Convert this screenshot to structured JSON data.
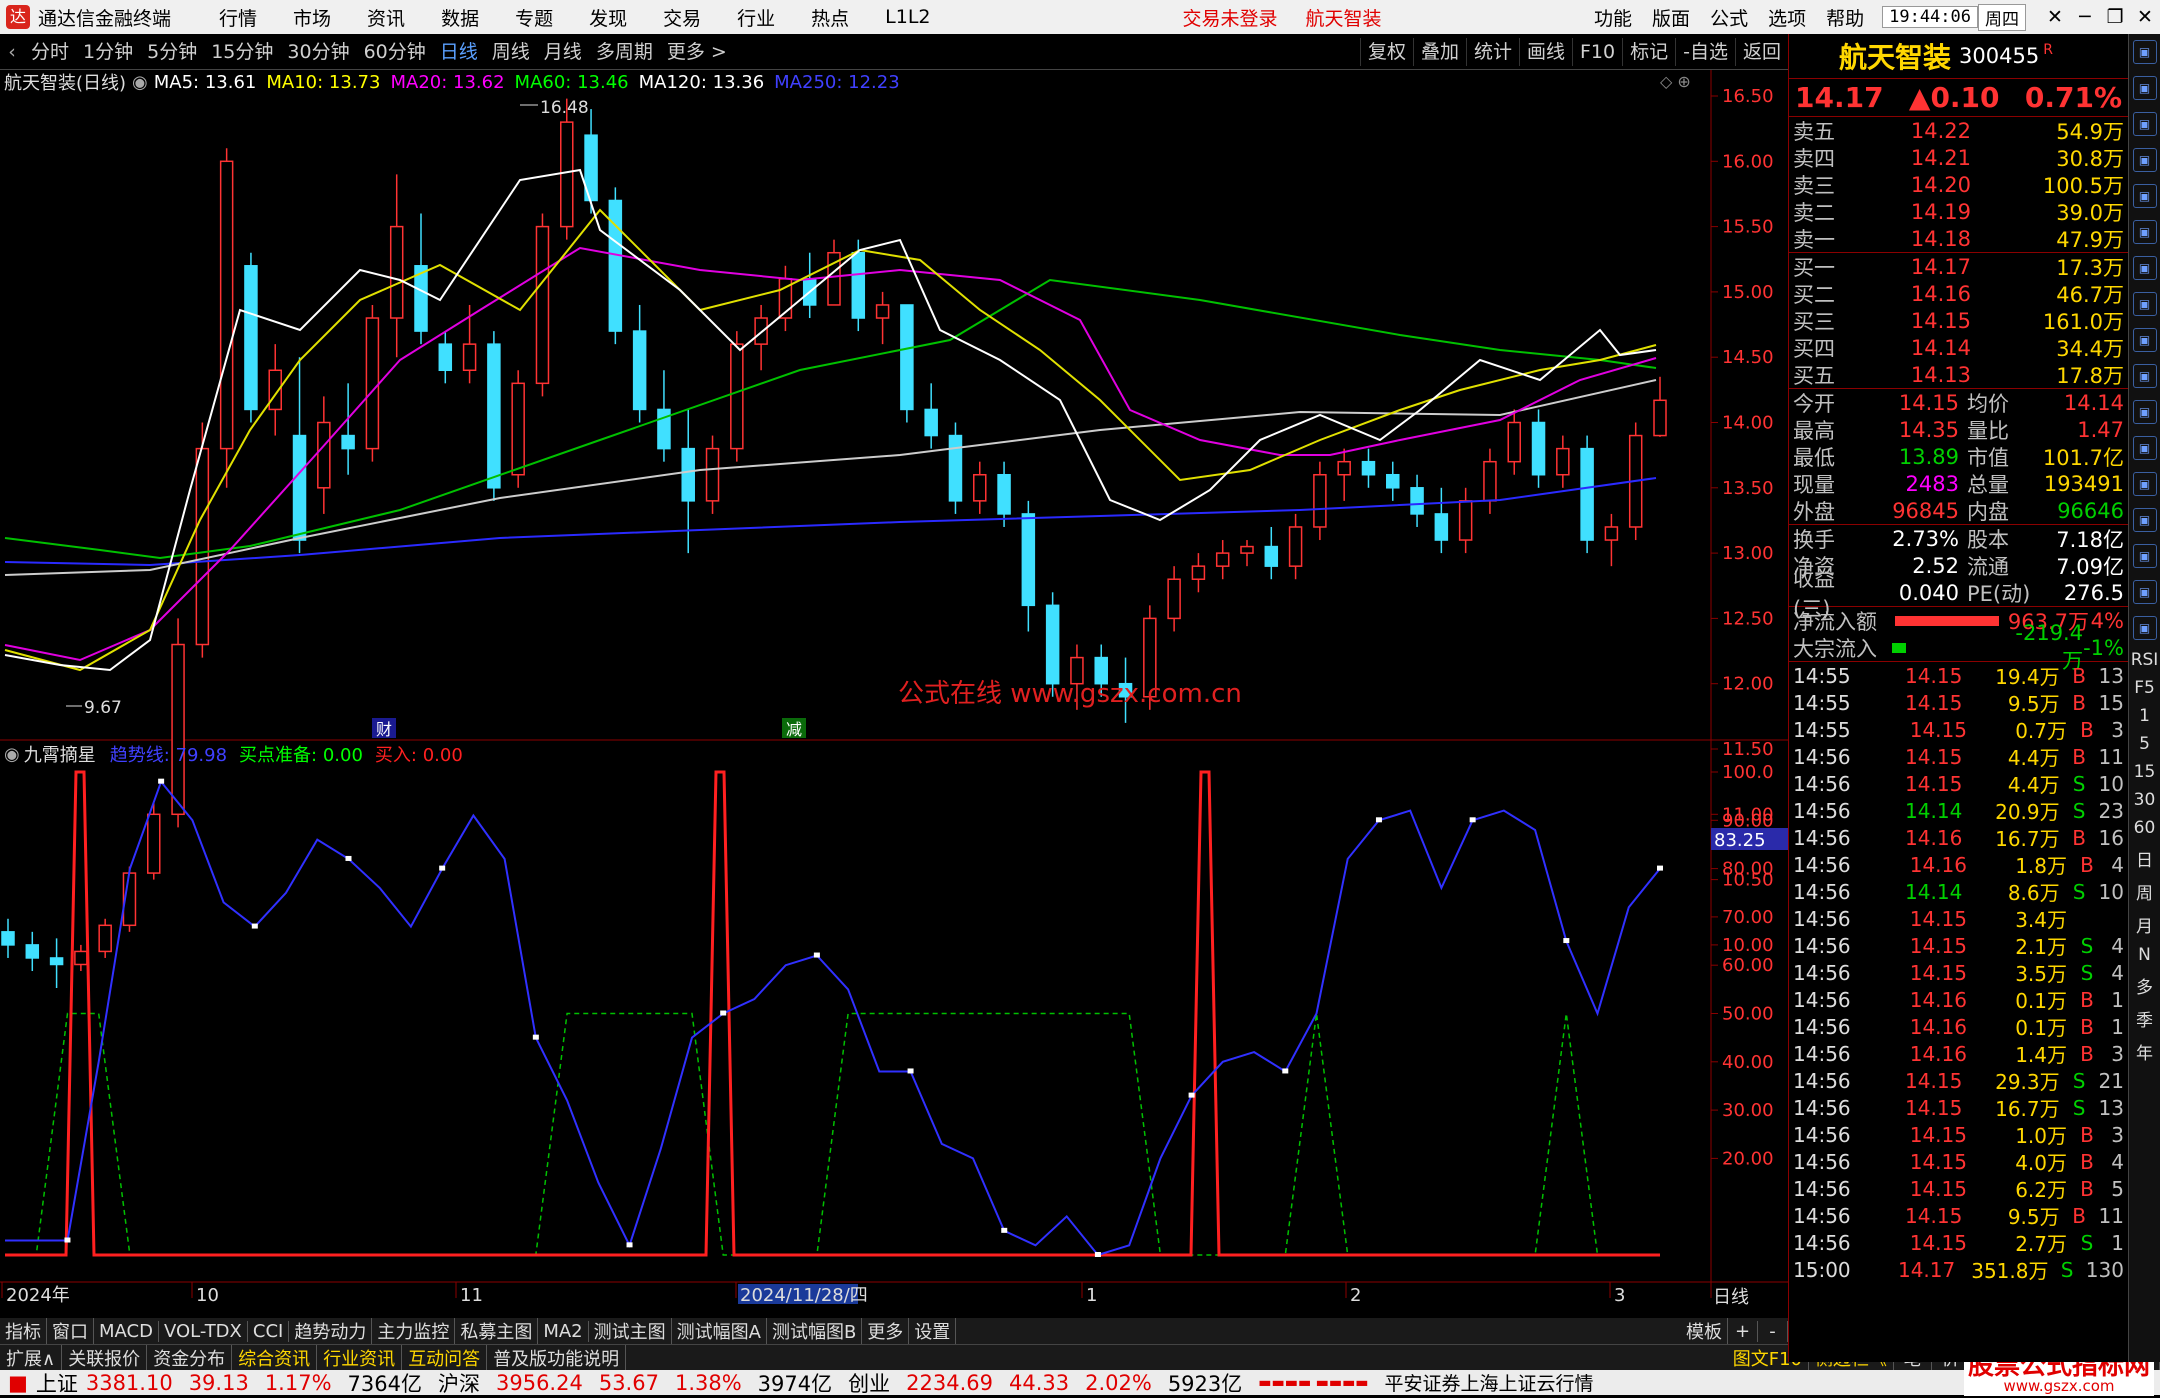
{
  "menubar": {
    "app_title": "通达信金融终端",
    "items": [
      "行情",
      "市场",
      "资讯",
      "数据",
      "专题",
      "发现",
      "交易",
      "行业",
      "热点",
      "L1L2"
    ],
    "trade_status": "交易未登录",
    "stock_name": "航天智装",
    "right_items": [
      "功能",
      "版面",
      "公式",
      "选项",
      "帮助"
    ],
    "time": "19:44:06",
    "weekday": "周四"
  },
  "toolbar": {
    "periods": [
      "分时",
      "1分钟",
      "5分钟",
      "15分钟",
      "30分钟",
      "60分钟",
      "日线",
      "周线",
      "月线",
      "多周期",
      "更多 >"
    ],
    "selected": "日线",
    "right": [
      "复权",
      "叠加",
      "统计",
      "画线",
      "F10",
      "标记",
      "-自选",
      "返回"
    ]
  },
  "main_chart": {
    "title": "航天智装(日线)",
    "ma_labels": [
      {
        "text": "MA5: 13.61",
        "color": "#ffffff"
      },
      {
        "text": "MA10: 13.73",
        "color": "#ffff00"
      },
      {
        "text": "MA20: 13.62",
        "color": "#ff00ff"
      },
      {
        "text": "MA60: 13.46",
        "color": "#00ff00"
      },
      {
        "text": "MA120: 13.36",
        "color": "#ffffff"
      },
      {
        "text": "MA250: 12.23",
        "color": "#4040ff"
      }
    ],
    "y_ticks": [
      "16.50",
      "16.00",
      "15.50",
      "15.00",
      "14.50",
      "14.00",
      "13.50",
      "13.00",
      "12.50",
      "12.00",
      "11.50",
      "11.00",
      "10.50",
      "10.00"
    ],
    "high_label": "16.48",
    "low_label": "9.67",
    "watermark": "公式在线 www.gszx.com.cn",
    "markers": [
      "财",
      "减"
    ]
  },
  "indicator": {
    "title": "九霄摘星",
    "lines": [
      {
        "text": "趋势线: 79.98",
        "color": "#4040ff"
      },
      {
        "text": "买点准备: 0.00",
        "color": "#00ff00"
      },
      {
        "text": "买入: 0.00",
        "color": "#ff2020"
      }
    ],
    "y_ticks": [
      "100.0",
      "90.00",
      "80.00",
      "70.00",
      "60.00",
      "50.00",
      "40.00",
      "30.00",
      "20.00"
    ],
    "current": "83.25"
  },
  "x_axis": {
    "labels": [
      "2024年",
      "10",
      "11",
      "2024/11/28/四",
      "1",
      "2",
      "3"
    ],
    "period": "日线"
  },
  "chart_data": {
    "type": "line",
    "x_labels": [
      "2024年",
      "10",
      "11",
      "2024/11/28/四",
      "1",
      "2",
      "3"
    ],
    "y_range": [
      0,
      100
    ],
    "series": [
      {
        "name": "趋势线",
        "values": [
          3,
          3,
          3,
          40,
          80,
          98,
          90,
          73,
          68,
          75,
          86,
          82,
          76,
          68,
          80,
          91,
          82,
          45,
          32,
          15,
          2,
          22,
          45,
          50,
          53,
          60,
          62,
          55,
          38,
          38,
          23,
          20,
          5,
          2,
          8,
          0,
          2,
          20,
          33,
          40,
          42,
          38,
          50,
          82,
          90,
          92,
          76,
          90,
          92,
          88,
          65,
          50,
          72,
          80
        ]
      },
      {
        "name": "买点准备",
        "values": [
          0,
          0,
          50,
          50,
          0,
          0,
          0,
          0,
          0,
          0,
          0,
          0,
          0,
          0,
          0,
          0,
          0,
          0,
          50,
          50,
          50,
          50,
          50,
          0,
          0,
          0,
          0,
          50,
          50,
          50,
          50,
          50,
          50,
          50,
          50,
          50,
          50,
          0,
          0,
          0,
          0,
          0,
          50,
          0,
          0,
          0,
          0,
          0,
          0,
          0,
          50,
          0,
          0,
          0
        ]
      }
    ]
  },
  "quote": {
    "name": "航天智装",
    "code": "300455",
    "flag": "R",
    "price": "14.17",
    "change": "▲0.10",
    "pct": "0.71%",
    "asks": [
      {
        "l": "卖五",
        "p": "14.22",
        "v": "54.9万"
      },
      {
        "l": "卖四",
        "p": "14.21",
        "v": "30.8万"
      },
      {
        "l": "卖三",
        "p": "14.20",
        "v": "100.5万"
      },
      {
        "l": "卖二",
        "p": "14.19",
        "v": "39.0万"
      },
      {
        "l": "卖一",
        "p": "14.18",
        "v": "47.9万"
      }
    ],
    "bids": [
      {
        "l": "买一",
        "p": "14.17",
        "v": "17.3万"
      },
      {
        "l": "买二",
        "p": "14.16",
        "v": "46.7万"
      },
      {
        "l": "买三",
        "p": "14.15",
        "v": "161.0万"
      },
      {
        "l": "买四",
        "p": "14.14",
        "v": "34.4万"
      },
      {
        "l": "买五",
        "p": "14.13",
        "v": "17.8万"
      }
    ],
    "stats": [
      [
        "今开",
        "14.15",
        "均价",
        "14.14"
      ],
      [
        "最高",
        "14.35",
        "量比",
        "1.47"
      ],
      [
        "最低",
        "13.89",
        "市值",
        "101.7亿"
      ],
      [
        "现量",
        "2483",
        "总量",
        "193491"
      ],
      [
        "外盘",
        "96845",
        "内盘",
        "96646"
      ]
    ],
    "stats2": [
      [
        "换手",
        "2.73%",
        "股本",
        "7.18亿"
      ],
      [
        "净资",
        "2.52",
        "流通",
        "7.09亿"
      ],
      [
        "收益(三)",
        "0.040",
        "PE(动)",
        "276.5"
      ]
    ],
    "flow": [
      {
        "l": "净流入额",
        "v": "963.7万",
        "p": "4%"
      },
      {
        "l": "大宗流入",
        "v": "-219.4万",
        "p": "-1%"
      }
    ]
  },
  "ticks": [
    [
      "14:55",
      "14.15",
      "19.4万",
      "B",
      "13"
    ],
    [
      "14:55",
      "14.15",
      "9.5万",
      "B",
      "15"
    ],
    [
      "14:55",
      "14.15",
      "0.7万",
      "B",
      "3"
    ],
    [
      "14:56",
      "14.15",
      "4.4万",
      "B",
      "11"
    ],
    [
      "14:56",
      "14.15",
      "4.4万",
      "S",
      "10"
    ],
    [
      "14:56",
      "14.14",
      "20.9万",
      "S",
      "23"
    ],
    [
      "14:56",
      "14.16",
      "16.7万",
      "B",
      "16"
    ],
    [
      "14:56",
      "14.16",
      "1.8万",
      "B",
      "4"
    ],
    [
      "14:56",
      "14.14",
      "8.6万",
      "S",
      "10"
    ],
    [
      "14:56",
      "14.15",
      "3.4万",
      "",
      ""
    ],
    [
      "14:56",
      "14.15",
      "2.1万",
      "S",
      "4"
    ],
    [
      "14:56",
      "14.15",
      "3.5万",
      "S",
      "4"
    ],
    [
      "14:56",
      "14.16",
      "0.1万",
      "B",
      "1"
    ],
    [
      "14:56",
      "14.16",
      "0.1万",
      "B",
      "1"
    ],
    [
      "14:56",
      "14.16",
      "1.4万",
      "B",
      "3"
    ],
    [
      "14:56",
      "14.15",
      "29.3万",
      "S",
      "21"
    ],
    [
      "14:56",
      "14.15",
      "16.7万",
      "S",
      "13"
    ],
    [
      "14:56",
      "14.15",
      "1.0万",
      "B",
      "3"
    ],
    [
      "14:56",
      "14.15",
      "4.0万",
      "B",
      "4"
    ],
    [
      "14:56",
      "14.15",
      "6.2万",
      "B",
      "5"
    ],
    [
      "14:56",
      "14.15",
      "9.5万",
      "B",
      "11"
    ],
    [
      "14:56",
      "14.15",
      "2.7万",
      "S",
      "1"
    ],
    [
      "15:00",
      "14.17",
      "351.8万",
      "S",
      "130"
    ]
  ],
  "bottom_tabs": {
    "row1": [
      "指标",
      "窗口",
      "MACD",
      "VOL-TDX",
      "CCI",
      "趋势动力",
      "主力监控",
      "私募主图",
      "MA2",
      "测试主图",
      "测试幅图A",
      "测试幅图B",
      "更多",
      "设置"
    ],
    "row1_right": [
      "模板",
      "+",
      "-"
    ],
    "row2": [
      "扩展∧",
      "关联报价",
      "资金分布",
      "综合资讯",
      "行业资讯",
      "互动问答",
      "普及版功能说明"
    ],
    "row2_right": [
      "图文F10",
      "侧边栏《",
      "笔",
      "价",
      "细",
      "势",
      "联",
      "值",
      "主"
    ]
  },
  "statusbar": {
    "indices": [
      {
        "n": "上证",
        "v": "3381.10",
        "c": "39.13",
        "p": "1.17%",
        "a": "7364亿"
      },
      {
        "n": "沪深",
        "v": "3956.24",
        "c": "53.67",
        "p": "1.38%",
        "a": "3974亿"
      },
      {
        "n": "创业",
        "v": "2234.69",
        "c": "44.33",
        "p": "2.02%",
        "a": "5923亿"
      }
    ],
    "broker": "平安证券上海上证云行情",
    "brand": "股票公式指标网",
    "brand_url": "www.gszx.com"
  },
  "sidebar": {
    "labels": [
      "RSI",
      "F5",
      "1",
      "5",
      "15",
      "30",
      "60",
      "日",
      "周",
      "月",
      "N",
      "多",
      "季",
      "年"
    ]
  }
}
